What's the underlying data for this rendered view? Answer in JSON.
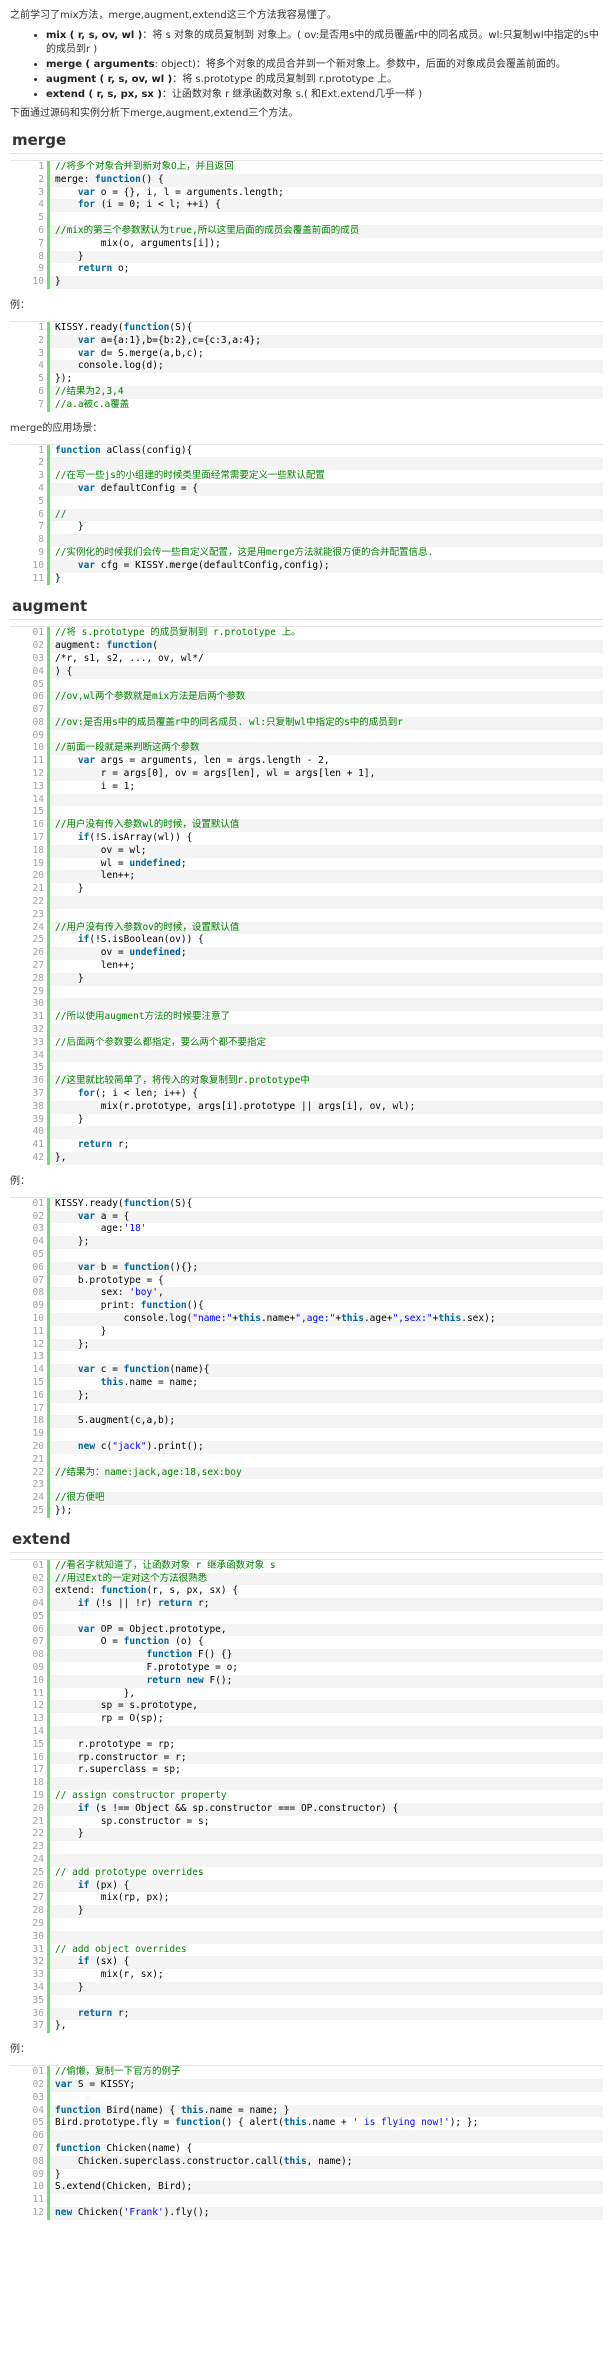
{
  "intro": "之前学习了mix方法，merge,augment,extend这三个方法我容易懂了。",
  "api_list": [
    {
      "sig": "mix ( r, s, ov, wl )",
      "desc": "：将 s 对象的成员复制到 对象上。( ov:是否用s中的成员覆盖r中的同名成员。wl:只复制wl中指定的s中的成员到r )"
    },
    {
      "sig": "merge ( arguments",
      "desc": ": object)：将多个对象的成员合并到一个新对象上。参数中，后面的对象成员会覆盖前面的。"
    },
    {
      "sig": "augment ( r, s, ov, wl )",
      "desc": "：将 s.prototype 的成员复制到 r.prototype 上。"
    },
    {
      "sig": "extend ( r, s, px, sx )",
      "desc": "：让函数对象 r 继承函数对象 s.( 和Ext.extend几乎一样 )"
    }
  ],
  "lead": "下面通过源码和实例分析下merge,augment,extend三个方法。",
  "sections": {
    "merge": {
      "title": "merge",
      "example_label": "例：",
      "usage_label": "merge的应用场景："
    },
    "augment": {
      "title": "augment",
      "example_label": "例："
    },
    "extend": {
      "title": "extend",
      "example_label": "例："
    }
  },
  "code_merge_src": [
    "1|//将多个对象合并到新对象O上，并且返回",
    "2|merge: function() {",
    "3|    var o = {}, i, l = arguments.length;",
    "4|    for (i = 0; i < l; ++i) {",
    "5|",
    "6|//mix的第三个参数默认为true,所以这里后面的成员会覆盖前面的成员",
    "7|        mix(o, arguments[i]);",
    "8|    }",
    "9|    return o;",
    "10|}"
  ],
  "code_merge_ex": [
    "1|KISSY.ready(function(S){",
    "2|    var a={a:1},b={b:2},c={c:3,a:4};",
    "3|    var d= S.merge(a,b,c);",
    "4|    console.log(d);",
    "5|});",
    "6|//结果为2,3,4",
    "7|//a.a被c.a覆盖"
  ],
  "code_merge_use": [
    "1|function aClass(config){",
    "2|",
    "3|//在写一些js的小组建的时候类里面经常需要定义一些默认配置",
    "4|    var defaultConfig = {",
    "5|",
    "6|//",
    "7|    }",
    "8|",
    "9|//实例化的时候我们会传一些自定义配置，这是用merge方法就能很方便的合并配置信息.",
    "10|    var cfg = KISSY.merge(defaultConfig,config);",
    "11|}"
  ],
  "code_augment_src": [
    "01|//将 s.prototype 的成员复制到 r.prototype 上。",
    "02|augment: function(",
    "03|/*r, s1, s2, ..., ov, wl*/",
    "04|) {",
    "05|",
    "06|//ov,wl两个参数就是mix方法是后两个参数",
    "07|",
    "08|//ov:是否用s中的成员覆盖r中的同名成员. wl:只复制wl中指定的s中的成员到r",
    "09|",
    "10|//前面一段就是来判断这两个参数",
    "11|    var args = arguments, len = args.length - 2,",
    "12|        r = args[0], ov = args[len], wl = args[len + 1],",
    "13|        i = 1;",
    "14|",
    "15|",
    "16|//用户没有传入参数wl的时候，设置默认值",
    "17|    if(!S.isArray(wl)) {",
    "18|        ov = wl;",
    "19|        wl = undefined;",
    "20|        len++;",
    "21|    }",
    "22|",
    "23|",
    "24|//用户没有传入参数ov的时候，设置默认值",
    "25|    if(!S.isBoolean(ov)) {",
    "26|        ov = undefined;",
    "27|        len++;",
    "28|    }",
    "29|",
    "30|",
    "31|//所以使用augment方法的时候要注意了",
    "32|",
    "33|//后面两个参数要么都指定，要么两个都不要指定",
    "34|",
    "35|",
    "36|//这里就比较简单了，将传入的对象复制到r.prototype中",
    "37|    for(; i < len; i++) {",
    "38|        mix(r.prototype, args[i].prototype || args[i], ov, wl);",
    "39|    }",
    "40|",
    "41|    return r;",
    "42|},"
  ],
  "code_augment_ex": [
    "01|KISSY.ready(function(S){",
    "02|    var a = {",
    "03|        age:'18'",
    "04|    };",
    "05|",
    "06|    var b = function(){};",
    "07|    b.prototype = {",
    "08|        sex: 'boy',",
    "09|        print: function(){",
    "10|            console.log(\"name:\"+this.name+\",age:\"+this.age+\",sex:\"+this.sex);",
    "11|        }",
    "12|    };",
    "13|",
    "14|    var c = function(name){",
    "15|        this.name = name;",
    "16|    };",
    "17|",
    "18|    S.augment(c,a,b);",
    "19|",
    "20|    new c(\"jack\").print();",
    "21|",
    "22|//结果为：name:jack,age:18,sex:boy",
    "23|",
    "24|//很方便吧",
    "25|});"
  ],
  "code_extend_src": [
    "01|//看名字就知道了，让函数对象 r 继承函数对象 s",
    "02|//用过Ext的一定对这个方法很熟悉",
    "03|extend: function(r, s, px, sx) {",
    "04|    if (!s || !r) return r;",
    "05|",
    "06|    var OP = Object.prototype,",
    "07|        O = function (o) {",
    "08|                function F() {}",
    "09|                F.prototype = o;",
    "10|                return new F();",
    "11|            },",
    "12|        sp = s.prototype,",
    "13|        rp = O(sp);",
    "14|",
    "15|    r.prototype = rp;",
    "16|    rp.constructor = r;",
    "17|    r.superclass = sp;",
    "18|",
    "19|// assign constructor property",
    "20|    if (s !== Object && sp.constructor === OP.constructor) {",
    "21|        sp.constructor = s;",
    "22|    }",
    "23|",
    "24|",
    "25|// add prototype overrides",
    "26|    if (px) {",
    "27|        mix(rp, px);",
    "28|    }",
    "29|",
    "30|",
    "31|// add object overrides",
    "32|    if (sx) {",
    "33|        mix(r, sx);",
    "34|    }",
    "35|",
    "36|    return r;",
    "37|},"
  ],
  "code_extend_ex": [
    "01|//偷懒，复制一下官方的例子",
    "02|var S = KISSY;",
    "03|",
    "04|function Bird(name) { this.name = name; }",
    "05|Bird.prototype.fly = function() { alert(this.name + ' is flying now!'); };",
    "06|",
    "07|function Chicken(name) {",
    "08|    Chicken.superclass.constructor.call(this, name);",
    "09|}",
    "10|S.extend(Chicken, Bird);",
    "11|",
    "12|new Chicken('Frank').fly();"
  ]
}
